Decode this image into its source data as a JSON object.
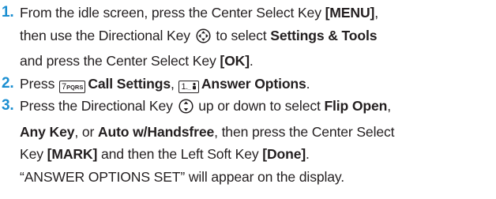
{
  "colors": {
    "step_number": "#1a8ed1",
    "text": "#231f20"
  },
  "icons": {
    "nav_four_way": "directional-key-four-way-icon",
    "nav_up_down": "directional-key-up-down-icon",
    "key_7": "keypad-7-pqrs-icon",
    "key_1": "keypad-1-voicemail-icon"
  },
  "key_labels": {
    "seven_digit": "7",
    "seven_letters": "PQRS",
    "one_digit": "1",
    "one_sub": "._"
  },
  "steps": [
    {
      "number": "1.",
      "t1": "From the idle screen, press the Center Select Key ",
      "b1": "[MENU]",
      "t2": ",",
      "t3": "then use the Directional Key ",
      "t4": " to select ",
      "b2": "Settings & Tools",
      "t5": "and press the Center Select Key ",
      "b3": "[OK]",
      "t6": "."
    },
    {
      "number": "2.",
      "t1": "Press ",
      "b1": "Call Settings",
      "t2": ", ",
      "b2": "Answer Options",
      "t3": "."
    },
    {
      "number": "3.",
      "t1": "Press the Directional Key ",
      "t2": " up or down to select ",
      "b1": "Flip Open",
      "t3": ",",
      "b2": "Any Key",
      "t4": ", or ",
      "b3": "Auto w/Handsfree",
      "t5": ", then press the Center Select",
      "t6": "Key ",
      "b4": "[MARK]",
      "t7": " and then the Left Soft Key ",
      "b5": "[Done]",
      "t8": ".",
      "t9": "“ANSWER OPTIONS SET” will appear on the display."
    }
  ]
}
